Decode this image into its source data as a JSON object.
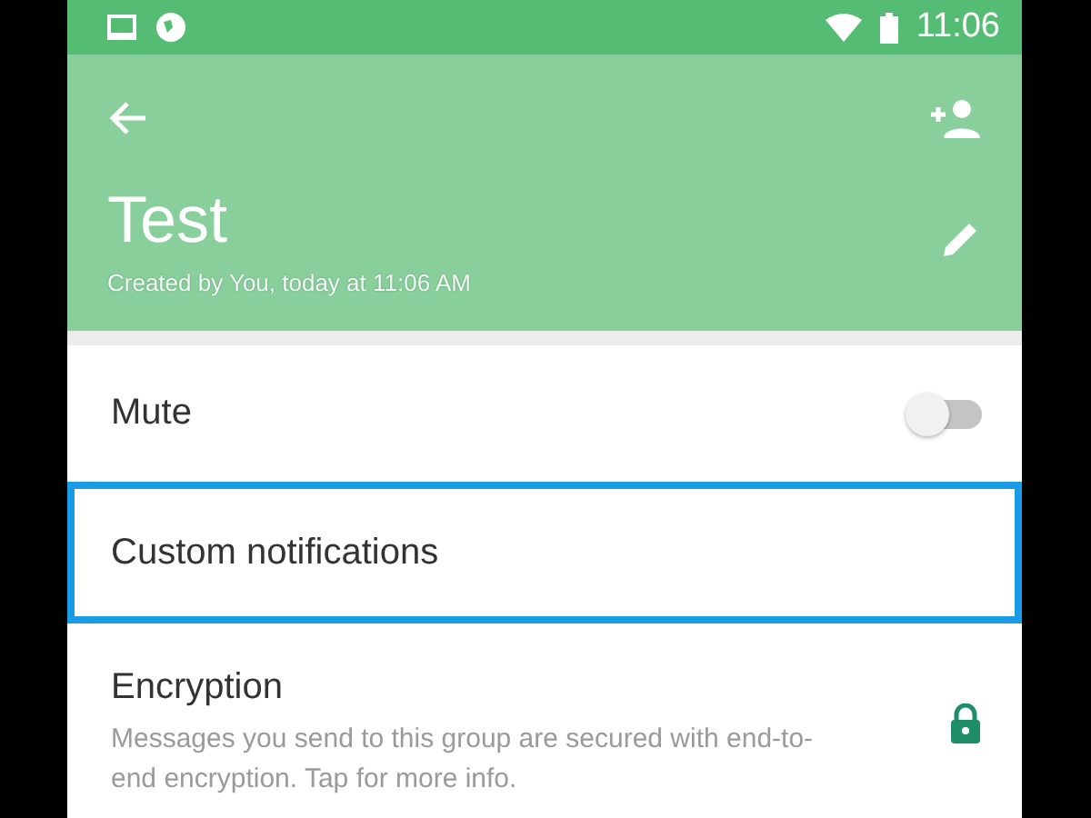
{
  "status_bar": {
    "time": "11:06"
  },
  "header": {
    "title": "Test",
    "subtitle": "Created by You, today at 11:06 AM"
  },
  "settings": [
    {
      "kind": "toggle",
      "label": "Mute",
      "on": false,
      "selected": false
    },
    {
      "kind": "plain",
      "label": "Custom notifications",
      "selected": true
    },
    {
      "kind": "info",
      "label": "Encryption",
      "description": "Messages you send to this group are secured with end-to-end encryption. Tap for more info.",
      "selected": false
    }
  ]
}
